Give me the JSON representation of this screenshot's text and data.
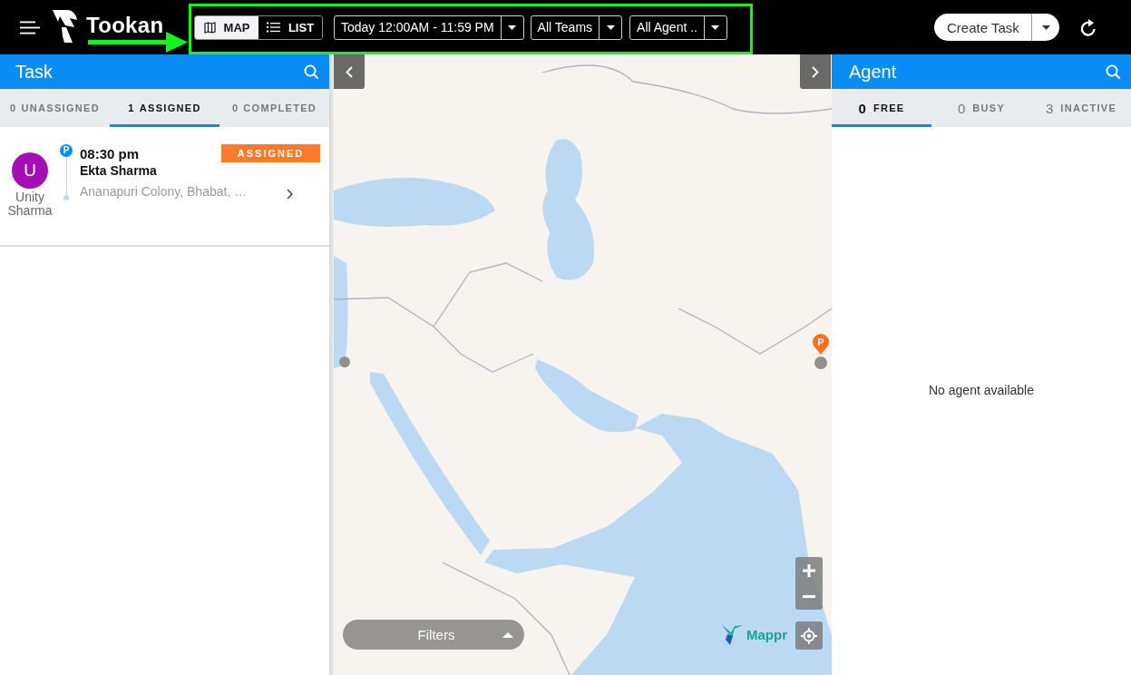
{
  "top_bar": {
    "brand": "Tookan",
    "view_toggle": [
      {
        "label": "MAP",
        "selected": true
      },
      {
        "label": "LIST",
        "selected": false
      }
    ],
    "filters": [
      {
        "label": "Today 12:00AM - 11:59 PM"
      },
      {
        "label": "All Teams"
      },
      {
        "label": "All Agent .."
      }
    ],
    "create_button": "Create Task"
  },
  "task_panel": {
    "title": "Task",
    "tabs": [
      {
        "count": "0",
        "label": "UNASSIGNED",
        "selected": false
      },
      {
        "count": "1",
        "label": "ASSIGNED",
        "selected": true
      },
      {
        "count": "0",
        "label": "COMPLETED",
        "selected": false
      }
    ],
    "tasks": [
      {
        "agent_initial": "U",
        "agent_name": "Unity Sharma",
        "marker": "P",
        "time": "08:30 pm",
        "status": "ASSIGNED",
        "customer": "Ekta Sharma",
        "address": "Ananapuri Colony, Bhabat, …"
      }
    ]
  },
  "map": {
    "pins": [
      {
        "label": "P"
      }
    ],
    "filters_button": "Filters",
    "attribution": "Mappr"
  },
  "agent_panel": {
    "title": "Agent",
    "tabs": [
      {
        "count": "0",
        "label": "FREE",
        "selected": true
      },
      {
        "count": "0",
        "label": "BUSY",
        "selected": false
      },
      {
        "count": "3",
        "label": "INACTIVE",
        "selected": false
      }
    ],
    "empty_message": "No agent available"
  },
  "annotations": {
    "highlight_frame": true,
    "pointer_arrow": true
  }
}
